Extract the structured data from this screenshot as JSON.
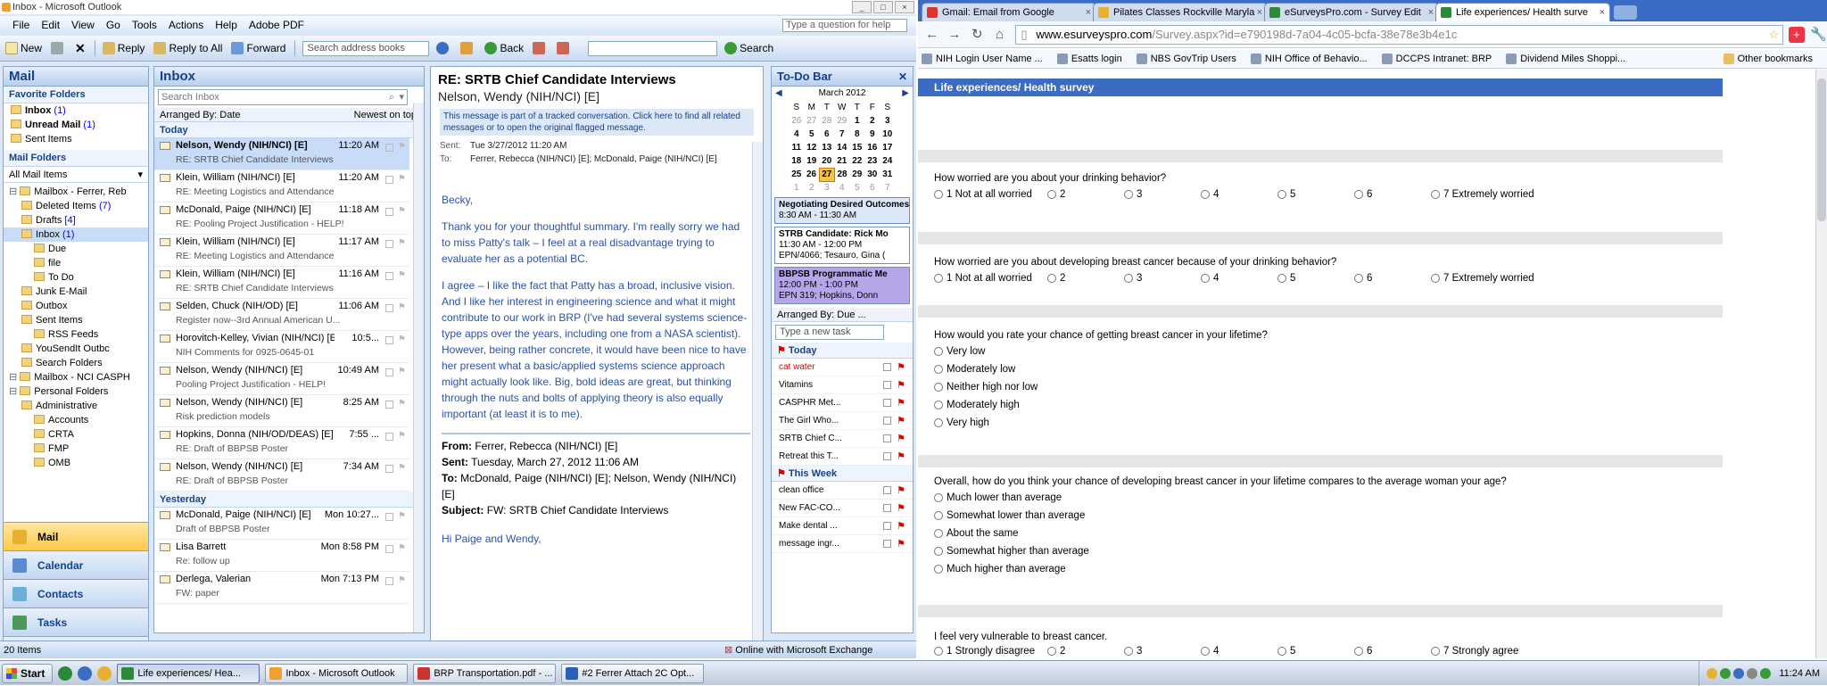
{
  "outlook": {
    "title": "Inbox - Microsoft Outlook",
    "menu": [
      "File",
      "Edit",
      "View",
      "Go",
      "Tools",
      "Actions",
      "Help",
      "Adobe PDF"
    ],
    "ask_placeholder": "Type a question for help",
    "toolbar": {
      "new": "New",
      "reply": "Reply",
      "reply_all": "Reply to All",
      "forward": "Forward",
      "address_books": "Search address books",
      "back": "Back",
      "search": "Search"
    },
    "nav": {
      "title": "Mail",
      "favorites_head": "Favorite Folders",
      "favorites": [
        {
          "label": "Inbox",
          "count": "(1)"
        },
        {
          "label": "Unread Mail",
          "count": "(1)"
        },
        {
          "label": "Sent Items",
          "count": ""
        }
      ],
      "mail_folders_head": "Mail Folders",
      "all_mail_items": "All Mail Items",
      "tree": [
        {
          "label": "Mailbox - Ferrer, Reb",
          "count": "",
          "indent": 0
        },
        {
          "label": "Deleted Items",
          "count": "(7)",
          "indent": 1
        },
        {
          "label": "Drafts",
          "count": "[4]",
          "indent": 1
        },
        {
          "label": "Inbox",
          "count": "(1)",
          "indent": 1
        },
        {
          "label": "Due",
          "count": "",
          "indent": 2
        },
        {
          "label": "file",
          "count": "",
          "indent": 2
        },
        {
          "label": "To Do",
          "count": "",
          "indent": 2
        },
        {
          "label": "Junk E-Mail",
          "count": "",
          "indent": 1
        },
        {
          "label": "Outbox",
          "count": "",
          "indent": 1
        },
        {
          "label": "Sent Items",
          "count": "",
          "indent": 1
        },
        {
          "label": "RSS Feeds",
          "count": "",
          "indent": 2
        },
        {
          "label": "YouSendIt Outbc",
          "count": "",
          "indent": 1
        },
        {
          "label": "Search Folders",
          "count": "",
          "indent": 1
        },
        {
          "label": "Mailbox - NCI CASPH",
          "count": "",
          "indent": 0
        },
        {
          "label": "Personal Folders",
          "count": "",
          "indent": 0
        },
        {
          "label": "Administrative",
          "count": "",
          "indent": 1
        },
        {
          "label": "Accounts",
          "count": "",
          "indent": 2
        },
        {
          "label": "CRTA",
          "count": "",
          "indent": 2
        },
        {
          "label": "FMP",
          "count": "",
          "indent": 2
        },
        {
          "label": "OMB",
          "count": "",
          "indent": 2
        }
      ],
      "buttons": [
        "Mail",
        "Calendar",
        "Contacts",
        "Tasks"
      ]
    },
    "inbox": {
      "title": "Inbox",
      "search_placeholder": "Search Inbox",
      "arranged_by": "Arranged By: Date",
      "sort": "Newest on top",
      "group_today": "Today",
      "group_yesterday": "Yesterday",
      "today": [
        {
          "from": "Nelson, Wendy (NIH/NCI) [E]",
          "time": "11:20 AM",
          "subject": "RE: SRTB Chief Candidate Interviews"
        },
        {
          "from": "Klein, William (NIH/NCI) [E]",
          "time": "11:20 AM",
          "subject": "RE: Meeting Logistics and Attendance"
        },
        {
          "from": "McDonald, Paige (NIH/NCI) [E]",
          "time": "11:18 AM",
          "subject": "RE: Pooling Project Justification - HELP!"
        },
        {
          "from": "Klein, William (NIH/NCI) [E]",
          "time": "11:17 AM",
          "subject": "RE: Meeting Logistics and Attendance"
        },
        {
          "from": "Klein, William (NIH/NCI) [E]",
          "time": "11:16 AM",
          "subject": "RE: SRTB Chief Candidate Interviews"
        },
        {
          "from": "Selden, Chuck (NIH/OD) [E]",
          "time": "11:06 AM",
          "subject": "Register now--3rd Annual American U..."
        },
        {
          "from": "Horovitch-Kelley, Vivian (NIH/NCI) [E]",
          "time": "10:5...",
          "subject": "NIH Comments for 0925-0645-01"
        },
        {
          "from": "Nelson, Wendy (NIH/NCI) [E]",
          "time": "10:49 AM",
          "subject": "Pooling Project Justification - HELP!"
        },
        {
          "from": "Nelson, Wendy (NIH/NCI) [E]",
          "time": "8:25 AM",
          "subject": "Risk prediction models"
        },
        {
          "from": "Hopkins, Donna (NIH/OD/DEAS) [E]",
          "time": "7:55 ...",
          "subject": "RE: Draft of BBPSB Poster"
        },
        {
          "from": "Nelson, Wendy (NIH/NCI) [E]",
          "time": "7:34 AM",
          "subject": "RE: Draft of BBPSB Poster"
        }
      ],
      "yesterday": [
        {
          "from": "McDonald, Paige (NIH/NCI) [E]",
          "time": "Mon 10:27...",
          "subject": "Draft of BBPSB Poster"
        },
        {
          "from": "Lisa Barrett",
          "time": "Mon 8:58 PM",
          "subject": "Re: follow up"
        },
        {
          "from": "Derlega, Valerian",
          "time": "Mon 7:13 PM",
          "subject": "FW: paper"
        }
      ]
    },
    "reading": {
      "subject": "RE: SRTB Chief Candidate Interviews",
      "from": "Nelson, Wendy (NIH/NCI) [E]",
      "info": "This message is part of a tracked conversation. Click here to find all related messages or to open the original flagged message.",
      "sent_label": "Sent:",
      "sent": "Tue 3/27/2012 11:20 AM",
      "to_label": "To:",
      "to": "Ferrer, Rebecca (NIH/NCI) [E]; McDonald, Paige (NIH/NCI) [E]",
      "greeting": "Becky,",
      "p1": "Thank you for your thoughtful summary. I'm really sorry we had to miss Patty's talk – I feel at a real disadvantage trying to evaluate her as a potential BC.",
      "p2": "I agree – I like the fact that Patty has a broad, inclusive vision. And I like her interest in engineering science and what it might contribute to our work in BRP (I've had several systems science-type apps over the years, including one from a NASA scientist). However, being rather concrete, it would have been nice to have her present what a basic/applied systems science approach might actually look like. Big, bold ideas are great, but thinking through the nuts and bolts of applying theory is also equally important (at least it is to me).",
      "fwd_from": "Ferrer, Rebecca (NIH/NCI) [E]",
      "fwd_sent": "Tuesday, March 27, 2012 11:06 AM",
      "fwd_to": "McDonald, Paige (NIH/NCI) [E]; Nelson, Wendy (NIH/NCI) [E]",
      "fwd_subject": "FW: SRTB Chief Candidate Interviews",
      "fwd_greeting": "Hi Paige and Wendy,"
    },
    "todo": {
      "title": "To-Do Bar",
      "month": "March 2012",
      "weekdays": [
        "S",
        "M",
        "T",
        "W",
        "T",
        "F",
        "S"
      ],
      "weeks": [
        [
          "26",
          "27",
          "28",
          "29",
          "1",
          "2",
          "3"
        ],
        [
          "4",
          "5",
          "6",
          "7",
          "8",
          "9",
          "10"
        ],
        [
          "11",
          "12",
          "13",
          "14",
          "15",
          "16",
          "17"
        ],
        [
          "18",
          "19",
          "20",
          "21",
          "22",
          "23",
          "24"
        ],
        [
          "25",
          "26",
          "27",
          "28",
          "29",
          "30",
          "31"
        ],
        [
          "1",
          "2",
          "3",
          "4",
          "5",
          "6",
          "7"
        ]
      ],
      "today_day": "27",
      "appointments": [
        {
          "title": "Negotiating Desired Outcomes",
          "time": "8:30 AM - 11:30 AM",
          "loc": ""
        },
        {
          "title": "STRB Candidate: Rick Mo",
          "time": "11:30 AM - 12:00 PM",
          "loc": "EPN/4066; Tesauro, Gina ("
        },
        {
          "title": "BBPSB Programmatic Me",
          "time": "12:00 PM - 1:00 PM",
          "loc": "EPN 319; Hopkins, Donn"
        }
      ],
      "arranged": "Arranged By: Due ...",
      "new_task": "Type a new task",
      "today_head": "Today",
      "tasks_today": [
        "cat water",
        "Vitamins",
        "CASPHR Met...",
        "The Girl Who...",
        "SRTB Chief C...",
        "Retreat this T..."
      ],
      "week_head": "This Week",
      "tasks_week": [
        "clean office",
        "New FAC-CO...",
        "Make dental ...",
        "message ingr..."
      ]
    },
    "status_items": "20 Items",
    "status_conn": "Online with Microsoft Exchange"
  },
  "chrome": {
    "tabs": [
      {
        "label": "Gmail: Email from Google",
        "fav": "#d33"
      },
      {
        "label": "Pilates Classes Rockville Maryla",
        "fav": "#e8b030"
      },
      {
        "label": "eSurveysPro.com - Survey Edit",
        "fav": "#2a8a3a"
      },
      {
        "label": "Life experiences/ Health surve",
        "fav": "#2a8a3a"
      }
    ],
    "url_host": "www.esurveyspro.com",
    "url_path": "/Survey.aspx?id=e790198d-7a04-4c05-bcfa-38e78e3b4e1c",
    "bookmarks": [
      "NIH Login User Name ...",
      "Esatts login",
      "NBS GovTrip Users",
      "NIH Office of Behavio...",
      "DCCPS Intranet: BRP",
      "Dividend Miles Shoppi..."
    ],
    "other_bookmarks": "Other bookmarks"
  },
  "survey": {
    "header": "Life experiences/ Health survey",
    "q1": "How worried are you about your drinking behavior?",
    "q1_opts": [
      "1 Not at all worried",
      "2",
      "3",
      "4",
      "5",
      "6",
      "7 Extremely worried"
    ],
    "q2": "How worried are you about developing breast cancer because of your drinking behavior?",
    "q2_opts": [
      "1 Not at all worried",
      "2",
      "3",
      "4",
      "5",
      "6",
      "7 Extremely worried"
    ],
    "q3": "How would you rate your chance of getting breast cancer in your lifetime?",
    "q3_opts": [
      "Very low",
      "Moderately low",
      "Neither high nor low",
      "Moderately high",
      "Very high"
    ],
    "q4": "Overall, how do you think your chance of developing breast cancer in your lifetime compares to the average woman your age?",
    "q4_opts": [
      "Much lower than average",
      "Somewhat lower than average",
      "About the same",
      "Somewhat higher than average",
      "Much higher than average"
    ],
    "q5": "I feel very vulnerable to breast cancer.",
    "q5_opts": [
      "1 Strongly disagree",
      "2",
      "3",
      "4",
      "5",
      "6",
      "7 Strongly agree"
    ]
  },
  "taskbar": {
    "start": "Start",
    "items": [
      {
        "label": "Life experiences/ Hea...",
        "color": "#2a8a3a",
        "active": true
      },
      {
        "label": "Inbox - Microsoft Outlook",
        "color": "#f0a030",
        "active": false
      },
      {
        "label": "BRP Transportation.pdf - ...",
        "color": "#c33",
        "active": false
      },
      {
        "label": "#2 Ferrer Attach 2C Opt...",
        "color": "#2b5fb8",
        "active": false
      }
    ],
    "clock": "11:24 AM"
  }
}
